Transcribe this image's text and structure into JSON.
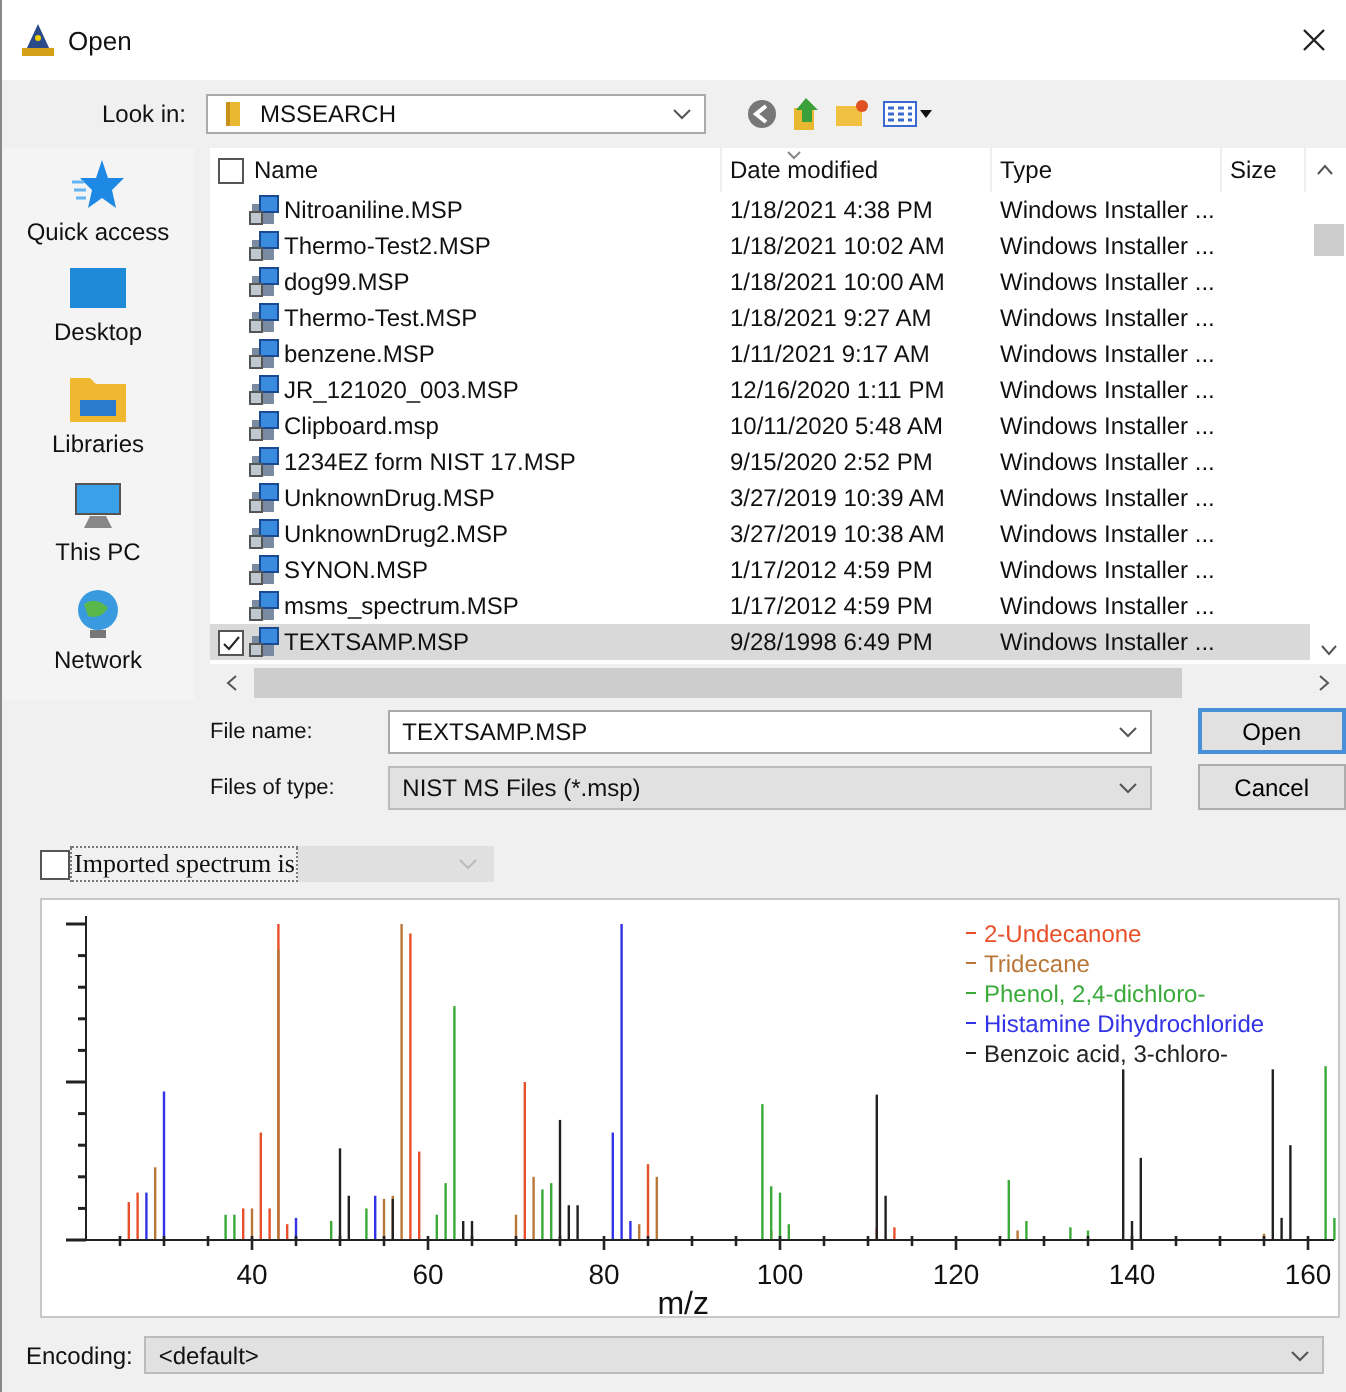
{
  "window": {
    "title": "Open"
  },
  "look_in": {
    "label": "Look in:",
    "value": "MSSEARCH"
  },
  "places": [
    {
      "label": "Quick access",
      "kind": "star"
    },
    {
      "label": "Desktop",
      "kind": "desktop"
    },
    {
      "label": "Libraries",
      "kind": "libraries"
    },
    {
      "label": "This PC",
      "kind": "pc"
    },
    {
      "label": "Network",
      "kind": "network"
    }
  ],
  "file_list": {
    "select_all_checked": false,
    "columns": [
      "Name",
      "Date modified",
      "Type",
      "Size"
    ],
    "rows": [
      {
        "name": "Nitroaniline.MSP",
        "date": "1/18/2021 4:38 PM",
        "type": "Windows Installer ...",
        "selected": false
      },
      {
        "name": "Thermo-Test2.MSP",
        "date": "1/18/2021 10:02 AM",
        "type": "Windows Installer ...",
        "selected": false
      },
      {
        "name": "dog99.MSP",
        "date": "1/18/2021 10:00 AM",
        "type": "Windows Installer ...",
        "selected": false
      },
      {
        "name": "Thermo-Test.MSP",
        "date": "1/18/2021 9:27 AM",
        "type": "Windows Installer ...",
        "selected": false
      },
      {
        "name": "benzene.MSP",
        "date": "1/11/2021 9:17 AM",
        "type": "Windows Installer ...",
        "selected": false
      },
      {
        "name": "JR_121020_003.MSP",
        "date": "12/16/2020 1:11 PM",
        "type": "Windows Installer ...",
        "selected": false
      },
      {
        "name": "Clipboard.msp",
        "date": "10/11/2020 5:48 AM",
        "type": "Windows Installer ...",
        "selected": false
      },
      {
        "name": "1234EZ form NIST 17.MSP",
        "date": "9/15/2020 2:52 PM",
        "type": "Windows Installer ...",
        "selected": false
      },
      {
        "name": "UnknownDrug.MSP",
        "date": "3/27/2019 10:39 AM",
        "type": "Windows Installer ...",
        "selected": false
      },
      {
        "name": "UnknownDrug2.MSP",
        "date": "3/27/2019 10:38 AM",
        "type": "Windows Installer ...",
        "selected": false
      },
      {
        "name": "SYNON.MSP",
        "date": "1/17/2012 4:59 PM",
        "type": "Windows Installer ...",
        "selected": false
      },
      {
        "name": "msms_spectrum.MSP",
        "date": "1/17/2012 4:59 PM",
        "type": "Windows Installer ...",
        "selected": false
      },
      {
        "name": "TEXTSAMP.MSP",
        "date": "9/28/1998 6:49 PM",
        "type": "Windows Installer ...",
        "selected": true
      }
    ]
  },
  "file_name": {
    "label": "File name:",
    "value": "TEXTSAMP.MSP"
  },
  "file_type": {
    "label": "Files of type:",
    "value": "NIST MS Files (*.msp)"
  },
  "buttons": [
    "Open",
    "Cancel"
  ],
  "imported": {
    "label": "Imported spectrum is",
    "checked": false
  },
  "spectrum": {
    "xlabel": "m/z",
    "xticks": [
      "40",
      "60",
      "80",
      "100",
      "120",
      "140",
      "160"
    ],
    "legend": [
      {
        "label": "2-Undecanone",
        "color": "#e8502a"
      },
      {
        "label": "Tridecane",
        "color": "#b8783a"
      },
      {
        "label": "Phenol, 2,4-dichloro-",
        "color": "#3aaa3a"
      },
      {
        "label": "Histamine Dihydrochloride",
        "color": "#3232e6"
      },
      {
        "label": "Benzoic acid, 3-chloro-",
        "color": "#222222"
      }
    ]
  },
  "encoding": {
    "label": "Encoding:",
    "value": "<default>"
  }
}
